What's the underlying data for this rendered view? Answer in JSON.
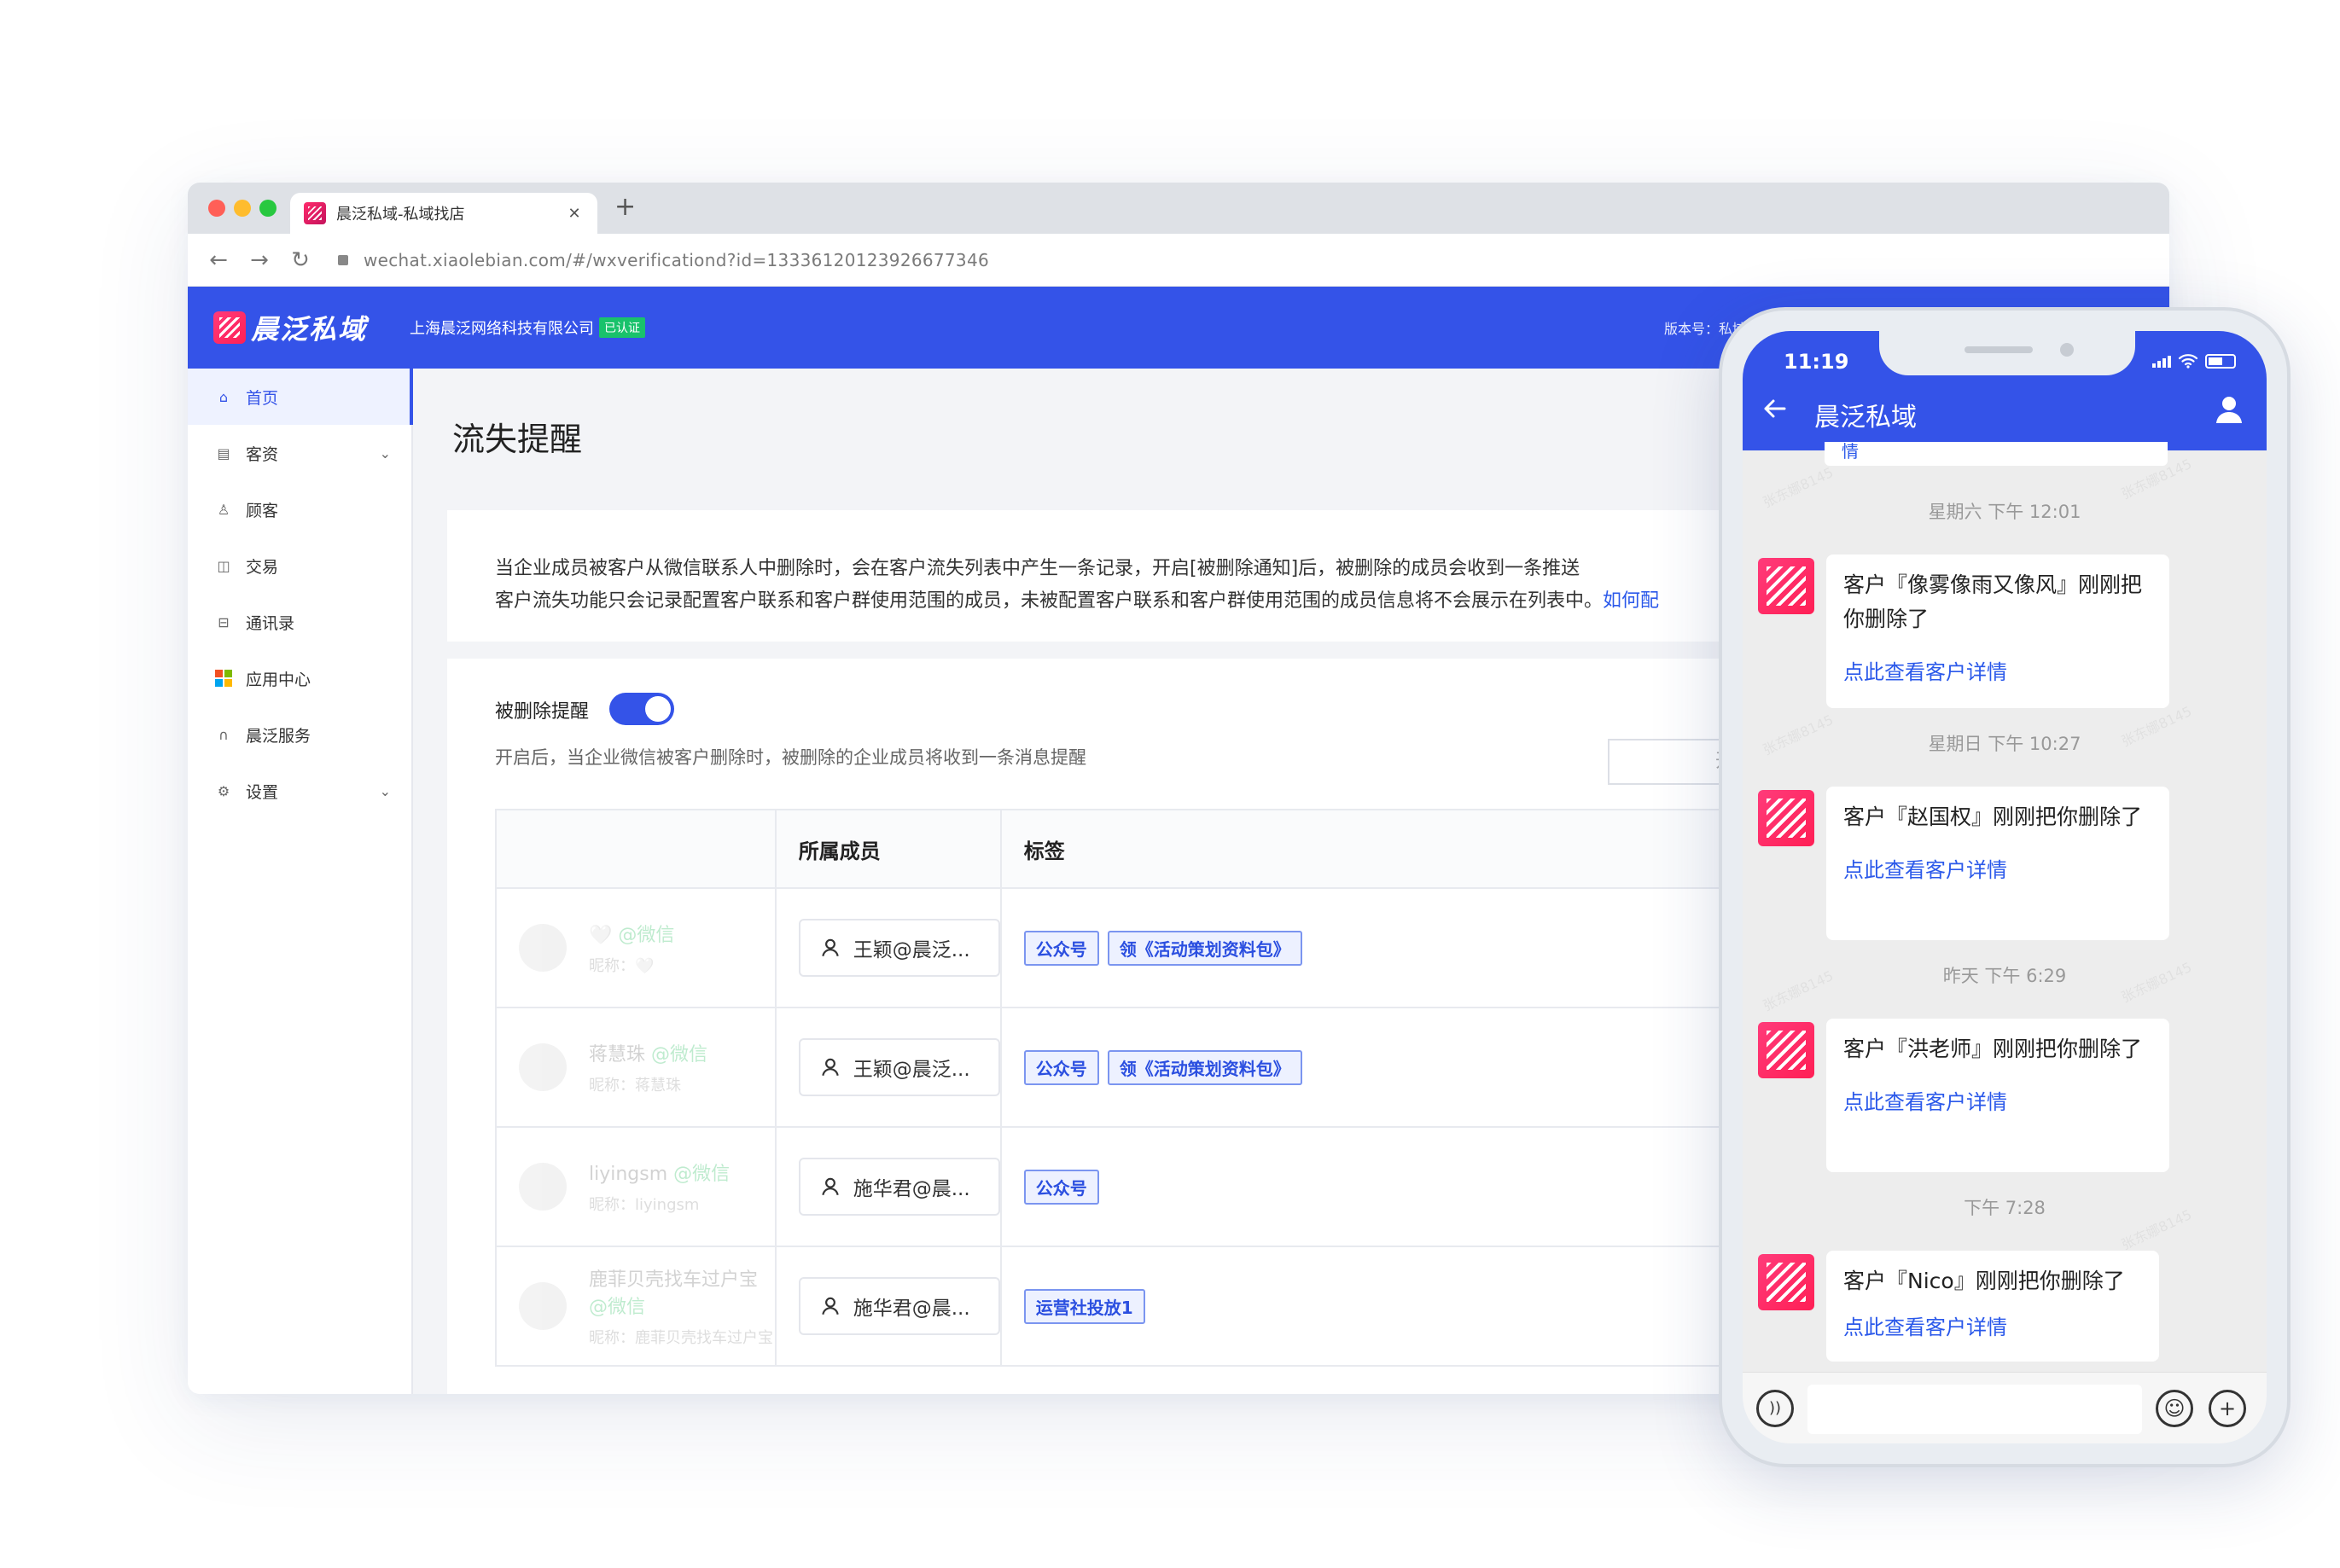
{
  "browser": {
    "tab_title": "晨泛私域-私域找店",
    "tab_close": "✕",
    "new_tab": "+",
    "url": "wechat.xiaolebian.com/#/wxverificationd?id=13336120123926677346",
    "nav": {
      "back": "←",
      "forward": "→",
      "reload": "↻"
    },
    "traffic_colors": [
      "#ff5f57",
      "#febc2e",
      "#28c840"
    ]
  },
  "header": {
    "brand": "晨泛私域",
    "company": "上海晨泛网络科技有限公司",
    "verified": "已认证",
    "version": "版本号：私域电",
    "accent": "#3453e8"
  },
  "sidebar": {
    "items": [
      {
        "label": "首页",
        "icon": "home-icon",
        "glyph": "⌂",
        "active": true
      },
      {
        "label": "客资",
        "icon": "contacts-icon",
        "glyph": "▤",
        "chevron": "⌄"
      },
      {
        "label": "顾客",
        "icon": "person-icon",
        "glyph": "♙"
      },
      {
        "label": "交易",
        "icon": "transaction-icon",
        "glyph": "◫"
      },
      {
        "label": "通讯录",
        "icon": "address-book-icon",
        "glyph": "⊟"
      },
      {
        "label": "应用中心",
        "icon": "apps-icon"
      },
      {
        "label": "晨泛服务",
        "icon": "headset-icon",
        "glyph": "∩"
      },
      {
        "label": "设置",
        "icon": "settings-icon",
        "glyph": "⚙",
        "chevron": "⌄"
      }
    ]
  },
  "main": {
    "title": "流失提醒",
    "notice_line1": "当企业成员被客户从微信联系人中删除时，会在客户流失列表中产生一条记录，开启[被删除通知]后，被删除的成员会收到一条推送",
    "notice_line2": "客户流失功能只会记录配置客户联系和客户群使用范围的成员，未被配置客户联系和客户群使用范围的成员信息将不会展示在列表中。",
    "notice_link": "如何配",
    "toggle_label": "被删除提醒",
    "toggle_on": true,
    "toggle_desc": "开启后，当企业微信被客户删除时，被删除的企业成员将收到一条消息提醒",
    "start_placeholder": "开始",
    "table": {
      "headers": [
        "",
        "所属成员",
        "标签"
      ],
      "rows": [
        {
          "name": "🤍",
          "source": "@微信",
          "alias": "昵称：🤍",
          "member": "王颖@晨泛...",
          "tags": [
            "公众号",
            "领《活动策划资料包》"
          ]
        },
        {
          "name": "蒋慧珠",
          "source": "@微信",
          "alias": "昵称：蒋慧珠",
          "member": "王颖@晨泛...",
          "tags": [
            "公众号",
            "领《活动策划资料包》"
          ]
        },
        {
          "name": "liyingsm",
          "source": "@微信",
          "alias": "昵称：liyingsm",
          "member": "施华君@晨...",
          "tags": [
            "公众号"
          ]
        },
        {
          "name": "鹿菲贝壳找车过户宝",
          "source": "@微信",
          "alias": "昵称：鹿菲贝壳找车过户宝",
          "member": "施华君@晨...",
          "tags": [
            "运营社投放1"
          ]
        }
      ]
    }
  },
  "phone": {
    "time": "11:19",
    "title": "晨泛私域",
    "prev_fragment": "情",
    "watermark": "张东娜8145",
    "messages": [
      {
        "time": "星期六 下午 12:01",
        "text": "客户『像雾像雨又像风』刚刚把你删除了",
        "link": "点此查看客户详情"
      },
      {
        "time": "星期日 下午 10:27",
        "text": "客户『赵国权』刚刚把你删除了",
        "link": "点此查看客户详情"
      },
      {
        "time": "昨天 下午 6:29",
        "text": "客户『洪老师』刚刚把你删除了",
        "link": "点此查看客户详情"
      },
      {
        "time": "下午 7:28",
        "text": "客户『Nico』刚刚把你删除了",
        "link": "点此查看客户详情"
      }
    ],
    "input_icons": {
      "voice": "))",
      "emoji": "☺",
      "plus": "+"
    }
  }
}
